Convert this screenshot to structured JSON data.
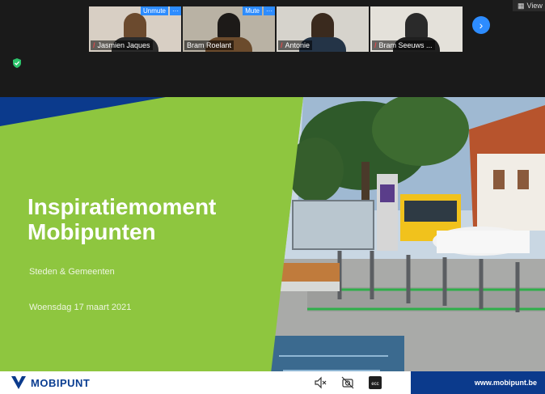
{
  "participants": [
    {
      "name": "Jasmien Jaques",
      "controls": [
        "Unmute",
        "···"
      ],
      "bg": "#d8cfc4",
      "hair": "#6b4a2e",
      "shirt": "#2b2b2b",
      "muted": true
    },
    {
      "name": "Bram Roelant",
      "controls": [
        "Mute",
        "···"
      ],
      "bg": "#b9b2a4",
      "hair": "#1d1a18",
      "shirt": "#6b4b2c",
      "muted": false
    },
    {
      "name": "Antonie",
      "controls": [],
      "bg": "#d6d3cc",
      "hair": "#3a2a1e",
      "shirt": "#243447",
      "muted": true
    },
    {
      "name": "Bram Seeuws ...",
      "controls": [],
      "bg": "#e4e1da",
      "hair": "#2a2a2a",
      "shirt": "#1f1f1f",
      "muted": true
    }
  ],
  "view_label": "View",
  "slide": {
    "title_line1": "Inspiratiemoment",
    "title_line2": "Mobipunten",
    "subtitle": "Steden & Gemeenten",
    "date": "Woensdag 17 maart 2021",
    "brand": "MOBIPUNT",
    "url": "www.mobipunt.be",
    "colors": {
      "green": "#8ec63f",
      "navy": "#0b3a8c"
    }
  },
  "footer_icons": [
    "speaker-mute-icon",
    "camera-off-icon",
    "cc-icon"
  ],
  "cc_label": "ecc"
}
